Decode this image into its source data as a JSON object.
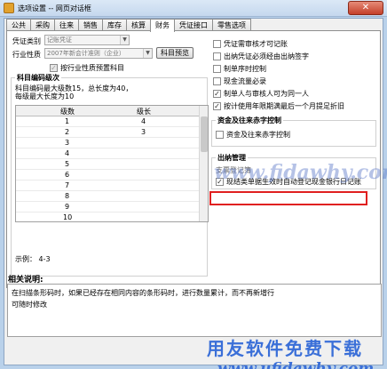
{
  "window": {
    "title": "选项设置 -- 网页对话框",
    "close_glyph": "✕"
  },
  "tabs": [
    {
      "label": "公共",
      "active": false
    },
    {
      "label": "采购",
      "active": false
    },
    {
      "label": "往来",
      "active": false
    },
    {
      "label": "销售",
      "active": false
    },
    {
      "label": "库存",
      "active": false
    },
    {
      "label": "核算",
      "active": false
    },
    {
      "label": "财务",
      "active": true
    },
    {
      "label": "凭证接口",
      "active": false
    },
    {
      "label": "零售选项",
      "active": false
    }
  ],
  "left": {
    "voucher_type_label": "凭证类别",
    "voucher_type_value": "记账凭证",
    "industry_label": "行业性质",
    "industry_value": "2007年新会计准则（企业）",
    "preset_subject_button": "科目预览",
    "by_industry_preset": "按行业性质预置科目",
    "subject_code_title": "科目编码级次",
    "subject_code_info_1": "科目编码最大级数15，总长度为40，",
    "subject_code_info_2": "每级最大长度为10",
    "grid_headers": [
      "级数",
      "级长"
    ],
    "grid_rows": [
      {
        "level": "1",
        "length": "4"
      },
      {
        "level": "2",
        "length": "3"
      },
      {
        "level": "3",
        "length": ""
      },
      {
        "level": "4",
        "length": ""
      },
      {
        "level": "5",
        "length": ""
      },
      {
        "level": "6",
        "length": ""
      },
      {
        "level": "7",
        "length": ""
      },
      {
        "level": "8",
        "length": ""
      },
      {
        "level": "9",
        "length": ""
      },
      {
        "level": "10",
        "length": ""
      }
    ],
    "example": "示例： 4-3"
  },
  "right": {
    "options": [
      {
        "label": "凭证需审核才可记账",
        "checked": false
      },
      {
        "label": "出纳凭证必须经由出纳签字",
        "checked": false
      },
      {
        "label": "制单序时控制",
        "checked": false
      },
      {
        "label": "现金流量必录",
        "checked": false
      },
      {
        "label": "制单人与审核人可为同一人",
        "checked": true
      },
      {
        "label": "按计使用年限期满最后一个月提足折旧",
        "checked": true
      }
    ],
    "settle_title": "资金及往来赤字控制",
    "settle_option": "资金及往来赤字控制",
    "cashier_title": "出纳管理",
    "cashier_hidden": "支票登记簿",
    "cashier_option": "现结类单据生效时自动登记现金银行日记账",
    "cashier_checked": true
  },
  "description": {
    "title": "相关说明:",
    "line1": "在扫描条形码时，如果已经存在相同内容的条形码时，进行数量累计，而不再新增行",
    "line2": "可随时修改"
  },
  "watermark": {
    "url": "www.fidawhy.com",
    "cn": "用友软件免费下载",
    "url2": "www.ufidawhy.com"
  }
}
